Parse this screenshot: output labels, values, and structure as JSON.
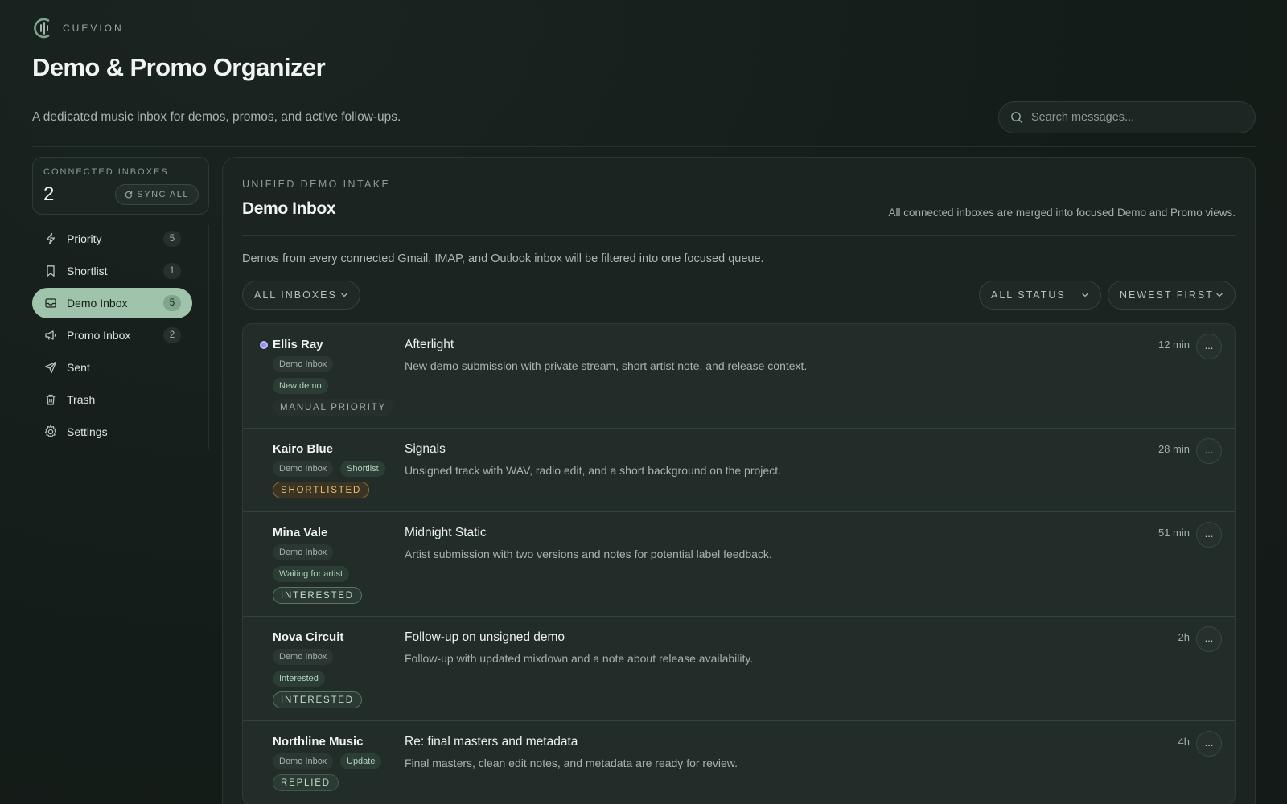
{
  "brand": {
    "name": "CUEVION",
    "logo_icon": "cuevion-logo-icon"
  },
  "header": {
    "title": "Demo & Promo Organizer",
    "subtitle": "A dedicated music inbox for demos, promos, and active follow-ups.",
    "search_placeholder": "Search messages..."
  },
  "sidebar": {
    "connected_label": "CONNECTED INBOXES",
    "connected_count": "2",
    "sync_label": "SYNC ALL",
    "items": [
      {
        "label": "Priority",
        "icon": "bolt-icon",
        "count": "5",
        "active": false
      },
      {
        "label": "Shortlist",
        "icon": "bookmark-icon",
        "count": "1",
        "active": false
      },
      {
        "label": "Demo Inbox",
        "icon": "inbox-icon",
        "count": "5",
        "active": true
      },
      {
        "label": "Promo Inbox",
        "icon": "megaphone-icon",
        "count": "2",
        "active": false
      },
      {
        "label": "Sent",
        "icon": "send-icon",
        "count": null,
        "active": false
      },
      {
        "label": "Trash",
        "icon": "trash-icon",
        "count": null,
        "active": false
      },
      {
        "label": "Settings",
        "icon": "gear-icon",
        "count": null,
        "active": false
      }
    ]
  },
  "main": {
    "eyebrow": "UNIFIED DEMO INTAKE",
    "title": "Demo Inbox",
    "note": "All connected inboxes are merged into focused Demo and Promo views.",
    "description": "Demos from every connected Gmail, IMAP, and Outlook inbox will be filtered into one focused queue.",
    "filters": {
      "inbox": "ALL INBOXES",
      "status": "ALL STATUS",
      "sort": "NEWEST FIRST"
    },
    "messages": [
      {
        "sender": "Ellis Ray",
        "unread": true,
        "tags": [
          "Demo Inbox",
          "New demo"
        ],
        "status": "MANUAL PRIORITY",
        "subject": "Afterlight",
        "preview": "New demo submission with private stream, short artist note, and release context.",
        "time": "12 min",
        "more_label": "..."
      },
      {
        "sender": "Kairo Blue",
        "unread": false,
        "tags": [
          "Demo Inbox",
          "Shortlist"
        ],
        "status": "SHORTLISTED",
        "subject": "Signals",
        "preview": "Unsigned track with WAV, radio edit, and a short background on the project.",
        "time": "28 min",
        "more_label": "..."
      },
      {
        "sender": "Mina Vale",
        "unread": false,
        "tags": [
          "Demo Inbox",
          "Waiting for artist"
        ],
        "status": "INTERESTED",
        "subject": "Midnight Static",
        "preview": "Artist submission with two versions and notes for potential label feedback.",
        "time": "51 min",
        "more_label": "..."
      },
      {
        "sender": "Nova Circuit",
        "unread": false,
        "tags": [
          "Demo Inbox",
          "Interested"
        ],
        "status": "INTERESTED",
        "subject": "Follow-up on unsigned demo",
        "preview": "Follow-up with updated mixdown and a note about release availability.",
        "time": "2h",
        "more_label": "..."
      },
      {
        "sender": "Northline Music",
        "unread": false,
        "tags": [
          "Demo Inbox",
          "Update"
        ],
        "status": "REPLIED",
        "subject": "Re: final masters and metadata",
        "preview": "Final masters, clean edit notes, and metadata are ready for review.",
        "time": "4h",
        "more_label": "..."
      }
    ]
  },
  "colors": {
    "background": "#141d19",
    "accent_active": "#9fc4ab",
    "unread_dot": "#9b8cf0",
    "shortlisted": "#e5be74"
  }
}
